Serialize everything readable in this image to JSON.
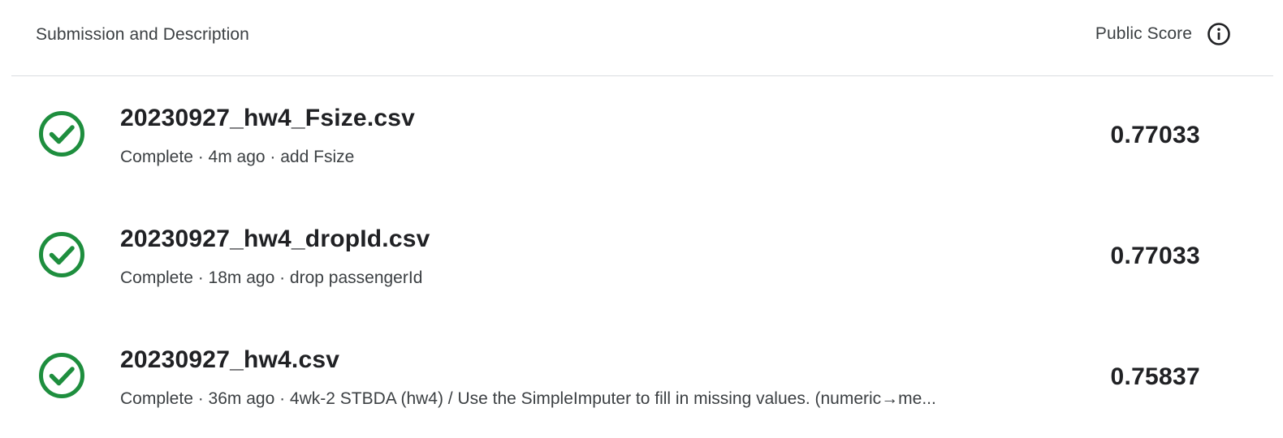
{
  "header": {
    "title": "Submission and Description",
    "score_label": "Public Score",
    "info_icon": "info-icon"
  },
  "submissions": [
    {
      "filename": "20230927_hw4_Fsize.csv",
      "meta": "Complete · 4m ago · add Fsize",
      "score": "0.77033",
      "status_icon": "check-circle-icon"
    },
    {
      "filename": "20230927_hw4_dropId.csv",
      "meta": "Complete · 18m ago · drop passengerId",
      "score": "0.77033",
      "status_icon": "check-circle-icon"
    },
    {
      "filename": "20230927_hw4.csv",
      "meta": "Complete · 36m ago · 4wk-2 STBDA (hw4) / Use the SimpleImputer to fill in missing values. (numeric→me...",
      "score": "0.75837",
      "status_icon": "check-circle-icon"
    }
  ],
  "colors": {
    "success": "#1e8e3e",
    "text_primary": "#202124",
    "text_secondary": "#3c4043",
    "divider": "#dadce0"
  }
}
